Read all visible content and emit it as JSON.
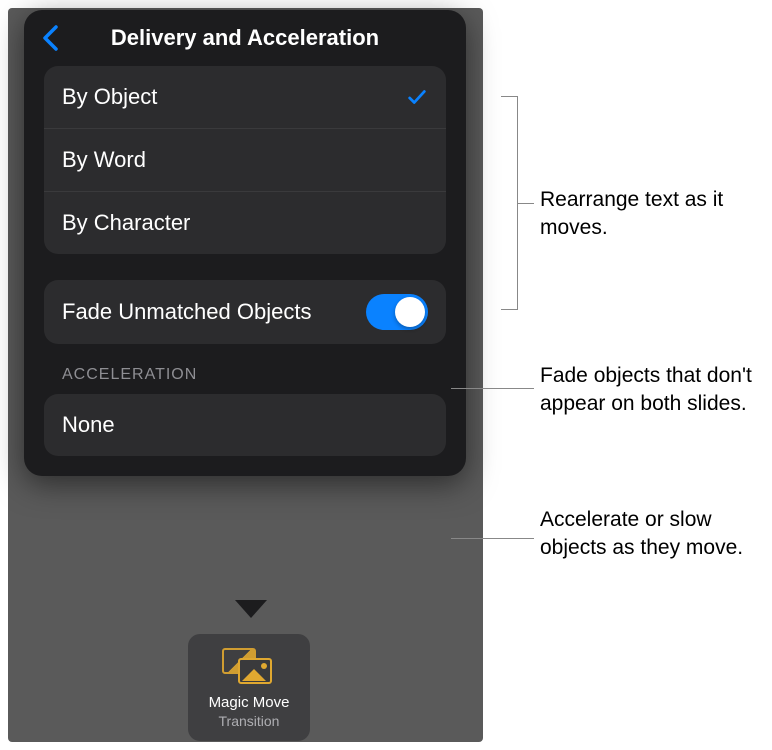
{
  "popover": {
    "title": "Delivery and Acceleration",
    "delivery_options": [
      {
        "label": "By Object",
        "selected": true
      },
      {
        "label": "By Word",
        "selected": false
      },
      {
        "label": "By Character",
        "selected": false
      }
    ],
    "fade_toggle": {
      "label": "Fade Unmatched Objects",
      "value": true
    },
    "acceleration_header": "ACCELERATION",
    "acceleration_options": [
      {
        "label": "None"
      }
    ]
  },
  "transition_card": {
    "title": "Magic Move",
    "subtitle": "Transition"
  },
  "callouts": {
    "delivery": "Rearrange text as it moves.",
    "fade": "Fade objects that don't appear on both slides.",
    "accel": "Accelerate or slow objects as they move."
  },
  "colors": {
    "accent": "#0a82ff",
    "panel": "#1c1c1e",
    "group": "#2c2c2e"
  }
}
